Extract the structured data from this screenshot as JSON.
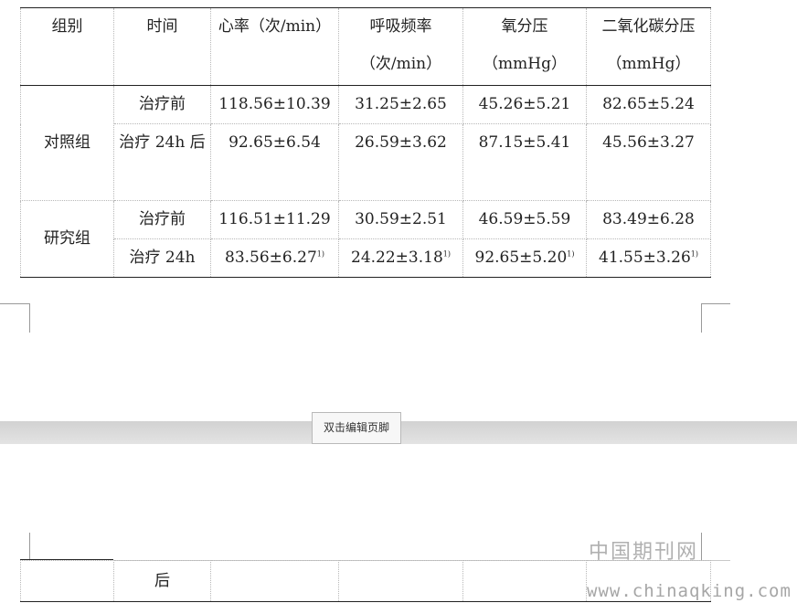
{
  "table": {
    "headers": [
      "组别",
      "时间",
      "心率（次/min）",
      "呼吸频率（次/min）",
      "氧分压（mmHg）",
      "二氧化碳分压（mmHg）"
    ],
    "groups": [
      {
        "name": "对照组",
        "rows": [
          {
            "time": "治疗前",
            "hr": "118.56±10.39",
            "rr": "31.25±2.65",
            "po2": "45.26±5.21",
            "pco2": "82.65±5.24"
          },
          {
            "time": "治疗 24h 后",
            "hr": "92.65±6.54",
            "rr": "26.59±3.62",
            "po2": "87.15±5.41",
            "pco2": "45.56±3.27"
          }
        ]
      },
      {
        "name": "研究组",
        "rows": [
          {
            "time": "治疗前",
            "hr": "116.51±11.29",
            "rr": "30.59±2.51",
            "po2": "46.59±5.59",
            "pco2": "83.49±6.28"
          },
          {
            "time": "治疗 24h",
            "hr": "83.56±6.27",
            "rr": "24.22±3.18",
            "po2": "92.65±5.20",
            "pco2": "41.55±3.26",
            "mark": "1)"
          }
        ]
      }
    ],
    "continuation": {
      "time": "后"
    }
  },
  "footer_button": {
    "label": "双击编辑页脚"
  },
  "watermark": {
    "cn": "中国期刊网",
    "url": "www.chinaqking.com"
  }
}
